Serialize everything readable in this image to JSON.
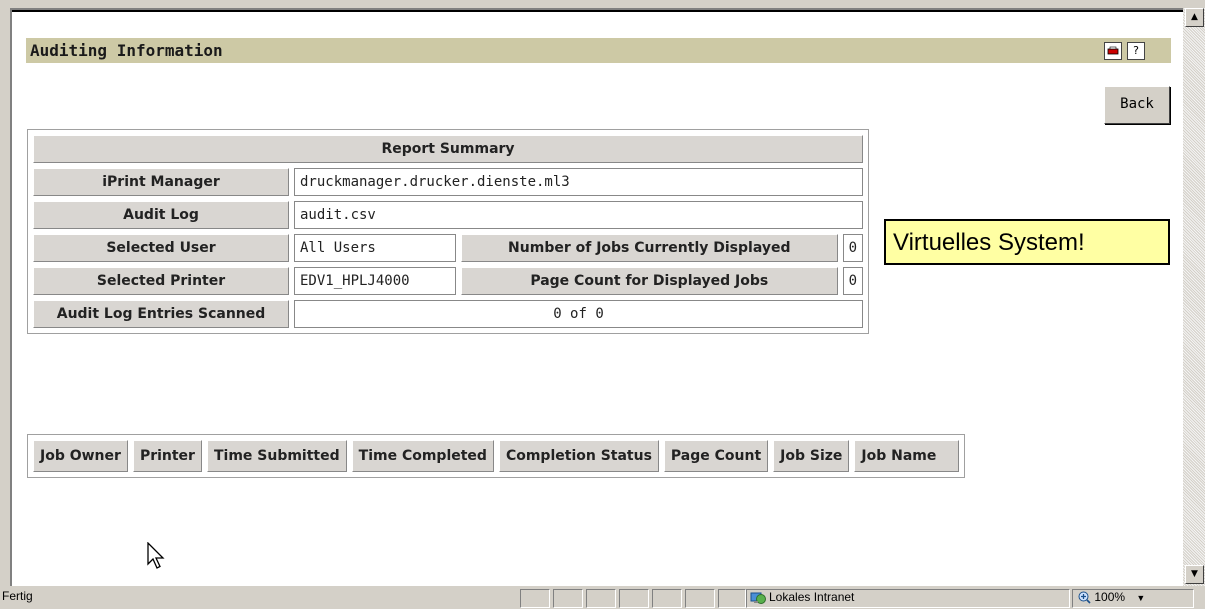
{
  "header": {
    "title": "Auditing Information",
    "icons": [
      "printer-icon",
      "help-icon"
    ]
  },
  "back_label": "Back",
  "summary": {
    "title": "Report Summary",
    "iprint_manager_label": "iPrint Manager",
    "iprint_manager_value": "druckmanager.drucker.dienste.ml3",
    "audit_log_label": "Audit Log",
    "audit_log_value": "audit.csv",
    "selected_user_label": "Selected User",
    "selected_user_value": "All Users",
    "jobs_displayed_label": "Number of Jobs Currently Displayed",
    "jobs_displayed_value": "0",
    "selected_printer_label": "Selected Printer",
    "selected_printer_value": "EDV1_HPLJ4000",
    "page_count_label": "Page Count for Displayed Jobs",
    "page_count_value": "0",
    "entries_scanned_label": "Audit Log Entries Scanned",
    "entries_scanned_value": "0 of 0"
  },
  "jobs_table": {
    "columns": [
      "Job Owner",
      "Printer",
      "Time Submitted",
      "Time Completed",
      "Completion Status",
      "Page Count",
      "Job Size",
      "Job Name"
    ]
  },
  "note": "Virtuelles System!",
  "statusbar": {
    "status": "Fertig",
    "zone": "Lokales Intranet",
    "zoom": "100%"
  }
}
